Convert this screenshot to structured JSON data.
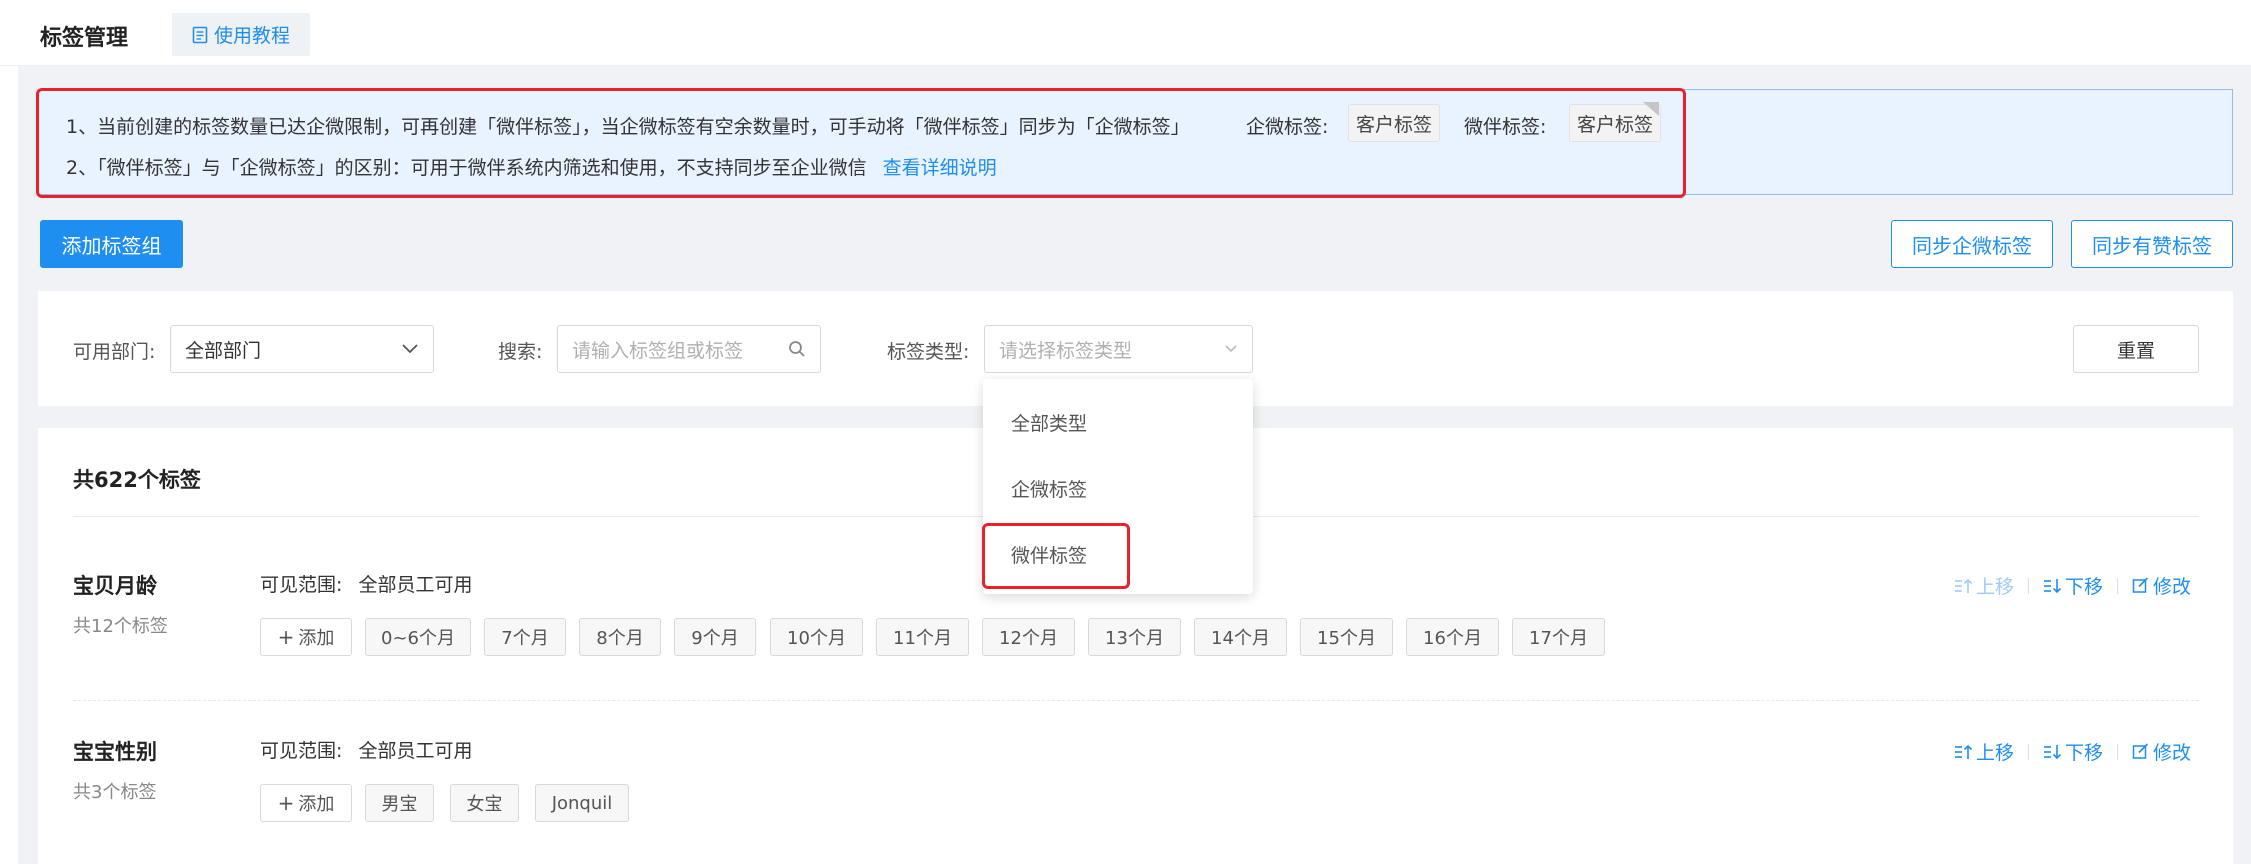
{
  "header": {
    "title": "标签管理",
    "tutorial_label": "使用教程"
  },
  "notice": {
    "line1": "1、当前创建的标签数量已达企微限制，可再创建「微伴标签」，当企微标签有空余数量时，可手动将「微伴标签」同步为「企微标签」",
    "qiwei_label": "企微标签:",
    "qiwei_tag": "客户标签",
    "weiban_label": "微伴标签:",
    "weiban_tag": "客户标签",
    "line2": "2、「微伴标签」与「企微标签」的区别：可用于微伴系统内筛选和使用，不支持同步至企业微信",
    "detail_link": "查看详细说明"
  },
  "toolbar": {
    "add_group": "添加标签组",
    "sync_qiwei": "同步企微标签",
    "sync_youzan": "同步有赞标签"
  },
  "filters": {
    "dept_label": "可用部门:",
    "dept_value": "全部部门",
    "search_label": "搜索:",
    "search_placeholder": "请输入标签组或标签",
    "type_label": "标签类型:",
    "type_placeholder": "请选择标签类型",
    "reset": "重置"
  },
  "type_dropdown": {
    "options": [
      "全部类型",
      "企微标签",
      "微伴标签"
    ]
  },
  "list": {
    "total": "共622个标签",
    "scope_label": "可见范围:",
    "add_tag": "添加",
    "actions": {
      "up": "上移",
      "down": "下移",
      "edit": "修改"
    },
    "groups": [
      {
        "name": "宝贝月龄",
        "count": "共12个标签",
        "scope": "全部员工可用",
        "tags": [
          "0~6个月",
          "7个月",
          "8个月",
          "9个月",
          "10个月",
          "11个月",
          "12个月",
          "13个月",
          "14个月",
          "15个月",
          "16个月",
          "17个月"
        ]
      },
      {
        "name": "宝宝性别",
        "count": "共3个标签",
        "scope": "全部员工可用",
        "tags": [
          "男宝",
          "女宝",
          "Jonquil"
        ]
      }
    ]
  },
  "colors": {
    "primary": "#1e8ef0",
    "highlight_red": "#e8222b",
    "notice_bg": "#e9f3ff",
    "page_bg": "#f0f2f5"
  }
}
